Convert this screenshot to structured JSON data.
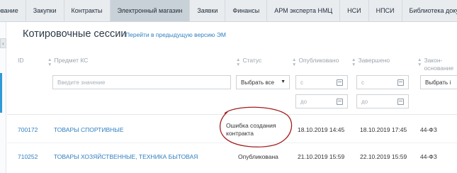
{
  "topnav": {
    "tabs": [
      {
        "label": "ование",
        "active": false
      },
      {
        "label": "Закупки",
        "active": false
      },
      {
        "label": "Контракты",
        "active": false
      },
      {
        "label": "Электронный магазин",
        "active": true
      },
      {
        "label": "Заявки",
        "active": false
      },
      {
        "label": "Финансы",
        "active": false
      },
      {
        "label": "АРМ эксперта НМЦ",
        "active": false
      },
      {
        "label": "НСИ",
        "active": false
      },
      {
        "label": "НПСИ",
        "active": false
      },
      {
        "label": "Библиотека документа",
        "active": false
      }
    ]
  },
  "sidebar": {
    "collapse_icon": "‹"
  },
  "header": {
    "title": "Котировочные сессии",
    "prev_version_link": "Перейти в предыдущую версию ЭМ"
  },
  "table": {
    "columns": {
      "id": "ID",
      "subject": "Предмет КС",
      "status": "Статус",
      "published": "Опубликовано",
      "finished": "Завершено",
      "law_line1": "Закон-",
      "law_line2": "основание"
    },
    "filters": {
      "subject_placeholder": "Введите значение",
      "status_value": "Выбрать все",
      "from_placeholder": "с",
      "to_placeholder": "до",
      "law_value": "Выбрать і"
    },
    "rows": [
      {
        "id": "700172",
        "subject": "ТОВАРЫ СПОРТИВНЫЕ",
        "status_line1": "Ошибка создания",
        "status_line2": "контракта",
        "published": "18.10.2019 14:45",
        "finished": "18.10.2019 17:45",
        "law": "44-ФЗ"
      },
      {
        "id": "710252",
        "subject": "ТОВАРЫ ХОЗЯЙСТВЕННЫЕ, ТЕХНИКА БЫТОВАЯ",
        "status_line1": "Опубликована",
        "status_line2": "",
        "published": "21.10.2019 15:59",
        "finished": "22.10.2019 15:59",
        "law": "44-ФЗ"
      }
    ]
  },
  "colors": {
    "accent": "#2f9ad6",
    "link": "#2f7fc1",
    "annotation": "#a31c1c"
  }
}
